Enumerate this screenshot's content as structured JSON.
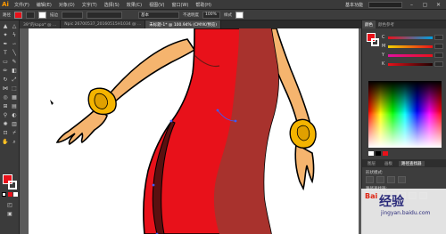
{
  "menubar": {
    "logo": "Ai",
    "items": [
      "文件(F)",
      "编辑(E)",
      "对象(O)",
      "文字(T)",
      "选择(S)",
      "效果(C)",
      "视图(V)",
      "窗口(W)",
      "帮助(H)"
    ],
    "workspace": "基本功能",
    "window_controls": [
      "–",
      "▢",
      "✕"
    ]
  },
  "controlbar": {
    "selection": "路径",
    "stroke_label": "描边",
    "stroke_style": "基本",
    "opacity_label": "不透明度",
    "opacity_value": "100%",
    "style_label": "样式"
  },
  "tabs": [
    {
      "label": "39°的kapa* @ ...",
      "active": false
    },
    {
      "label": "Npic 26700537_20160515H1034 @ ...",
      "active": false
    },
    {
      "label": "未标题-1* @ 100.94% (CMYK/预览)",
      "active": true
    }
  ],
  "colors": {
    "fill": "#e8111a",
    "dress_red": "#e8111a",
    "dress_shadow": "#a8322d",
    "skin": "#f5b46e",
    "bracelet": "#f4b400"
  },
  "panel": {
    "tabs": [
      "颜色",
      "颜色参考"
    ],
    "sliders": [
      "C",
      "M",
      "Y",
      "K"
    ],
    "section2_tabs": [
      "图层",
      "画板"
    ],
    "section3": "路径查找器",
    "section3_label": "形状模式:",
    "section4_label": "路径查找器:"
  },
  "watermark": {
    "brand": "Bai",
    "main": "经验",
    "url": "jingyan.baidu.com"
  }
}
